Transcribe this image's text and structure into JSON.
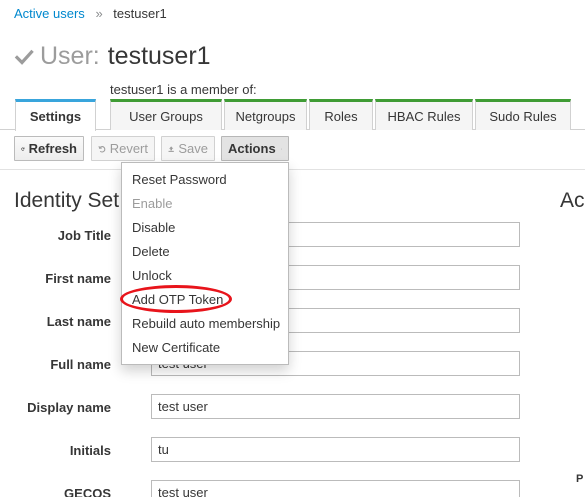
{
  "breadcrumb": {
    "link": "Active users",
    "separator": "»",
    "current": "testuser1"
  },
  "header": {
    "prefix": "User:",
    "entity": "testuser1"
  },
  "member_of_label": "testuser1 is a member of:",
  "tabs": [
    {
      "label": "Settings",
      "active": true
    },
    {
      "label": "User Groups"
    },
    {
      "label": "Netgroups"
    },
    {
      "label": "Roles"
    },
    {
      "label": "HBAC Rules"
    },
    {
      "label": "Sudo Rules"
    }
  ],
  "toolbar": {
    "refresh": "Refresh",
    "revert": "Revert",
    "save": "Save",
    "actions": "Actions"
  },
  "sections": {
    "left_heading": "Identity Set",
    "right_heading": "Ac"
  },
  "fields": [
    {
      "label": "Job Title",
      "value": "",
      "required": false
    },
    {
      "label": "First name",
      "value": "",
      "required": true
    },
    {
      "label": "Last name",
      "value": "",
      "required": true
    },
    {
      "label": "Full name",
      "value": "test user",
      "required": true
    },
    {
      "label": "Display name",
      "value": "test user",
      "required": false
    },
    {
      "label": "Initials",
      "value": "tu",
      "required": false
    },
    {
      "label": "GECOS",
      "value": "test user",
      "required": false
    }
  ],
  "required_marker": "*",
  "side_letter": "P",
  "actions_menu": [
    {
      "label": "Reset Password",
      "enabled": true
    },
    {
      "label": "Enable",
      "enabled": false
    },
    {
      "label": "Disable",
      "enabled": true
    },
    {
      "label": "Delete",
      "enabled": true
    },
    {
      "label": "Unlock",
      "enabled": true
    },
    {
      "label": "Add OTP Token",
      "enabled": true,
      "highlighted": true
    },
    {
      "label": "Rebuild auto membership",
      "enabled": true
    },
    {
      "label": "New Certificate",
      "enabled": true
    }
  ],
  "colors": {
    "link": "#0088ce",
    "tab_accent": "#3f9c35",
    "active_tab_accent": "#39a5dc",
    "highlight": "#e8141b"
  },
  "icons": [
    "check-icon",
    "refresh-icon",
    "undo-icon",
    "upload-icon",
    "caret-down-icon"
  ]
}
